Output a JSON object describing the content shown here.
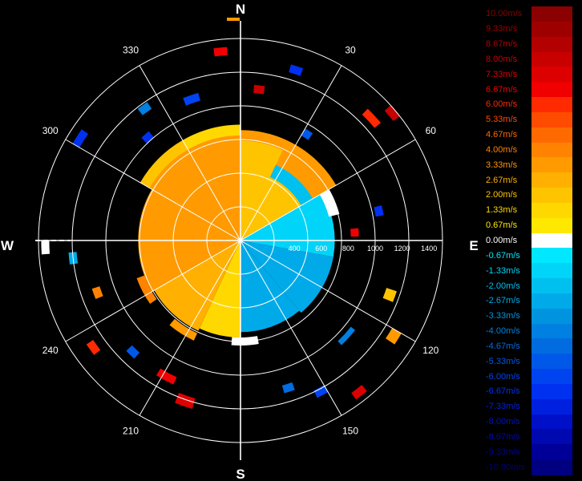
{
  "chart_data": {
    "type": "polar-heatmap",
    "cardinal": {
      "north": "N",
      "south": "S",
      "east": "E",
      "west": "W"
    },
    "azimuth_labels": [
      {
        "deg": 30,
        "text": "30"
      },
      {
        "deg": 60,
        "text": "60"
      },
      {
        "deg": 120,
        "text": "120"
      },
      {
        "deg": 150,
        "text": "150"
      },
      {
        "deg": 210,
        "text": "210"
      },
      {
        "deg": 240,
        "text": "240"
      },
      {
        "deg": 300,
        "text": "300"
      },
      {
        "deg": 330,
        "text": "330"
      }
    ],
    "range_ticks": [
      {
        "value": 400,
        "text": "400"
      },
      {
        "value": 600,
        "text": "600"
      },
      {
        "value": 800,
        "text": "800"
      },
      {
        "value": 1000,
        "text": "1000"
      },
      {
        "value": 1200,
        "text": "1200"
      },
      {
        "value": 1400,
        "text": "1400"
      }
    ],
    "range_max": 1500,
    "ring_count": 6,
    "radial_spoke_step_deg": 30,
    "colorbar": [
      {
        "label": "10.00m/s",
        "value": 10.0,
        "color": "#8b0000"
      },
      {
        "label": "9.33m/s",
        "value": 9.33,
        "color": "#9e0000"
      },
      {
        "label": "8.67m/s",
        "value": 8.67,
        "color": "#b30000"
      },
      {
        "label": "8.00m/s",
        "value": 8.0,
        "color": "#c80000"
      },
      {
        "label": "7.33m/s",
        "value": 7.33,
        "color": "#dd0000"
      },
      {
        "label": "6.67m/s",
        "value": 6.67,
        "color": "#f00000"
      },
      {
        "label": "6.00m/s",
        "value": 6.0,
        "color": "#ff2a00"
      },
      {
        "label": "5.33m/s",
        "value": 5.33,
        "color": "#ff4b00"
      },
      {
        "label": "4.67m/s",
        "value": 4.67,
        "color": "#ff6a00"
      },
      {
        "label": "4.00m/s",
        "value": 4.0,
        "color": "#ff8300"
      },
      {
        "label": "3.33m/s",
        "value": 3.33,
        "color": "#ff9a00"
      },
      {
        "label": "2.67m/s",
        "value": 2.67,
        "color": "#ffb000"
      },
      {
        "label": "2.00m/s",
        "value": 2.0,
        "color": "#ffc400"
      },
      {
        "label": "1.33m/s",
        "value": 1.33,
        "color": "#ffd800"
      },
      {
        "label": "0.67m/s",
        "value": 0.67,
        "color": "#ffe800"
      },
      {
        "label": "0.00m/s",
        "value": 0.0,
        "color": "#ffffff"
      },
      {
        "label": "-0.67m/s",
        "value": -0.67,
        "color": "#00e8ff"
      },
      {
        "label": "-1.33m/s",
        "value": -1.33,
        "color": "#00d4f8"
      },
      {
        "label": "-2.00m/s",
        "value": -2.0,
        "color": "#00c0f0"
      },
      {
        "label": "-2.67m/s",
        "value": -2.67,
        "color": "#00aae8"
      },
      {
        "label": "-3.33m/s",
        "value": -3.33,
        "color": "#0094e0"
      },
      {
        "label": "-4.00m/s",
        "value": -4.0,
        "color": "#0080e0"
      },
      {
        "label": "-4.67m/s",
        "value": -4.67,
        "color": "#006ce0"
      },
      {
        "label": "-5.33m/s",
        "value": -5.33,
        "color": "#0058e8"
      },
      {
        "label": "-6.00m/s",
        "value": -6.0,
        "color": "#0044f0"
      },
      {
        "label": "-6.67m/s",
        "value": -6.67,
        "color": "#0030f0"
      },
      {
        "label": "-7.33m/s",
        "value": -7.33,
        "color": "#0020e0"
      },
      {
        "label": "-8.00m/s",
        "value": -8.0,
        "color": "#0010c8"
      },
      {
        "label": "-8.67m/s",
        "value": -8.67,
        "color": "#0008b0"
      },
      {
        "label": "-9.33m/s",
        "value": -9.33,
        "color": "#000098"
      },
      {
        "label": "-10.00m/s",
        "value": -10.0,
        "color": "#000080"
      }
    ],
    "bins": [
      {
        "az": [
          300,
          60
        ],
        "r": [
          0,
          820
        ],
        "value": 3.0
      },
      {
        "az": [
          270,
          300
        ],
        "r": [
          0,
          760
        ],
        "value": 3.4
      },
      {
        "az": [
          240,
          270
        ],
        "r": [
          0,
          760
        ],
        "value": 3.2
      },
      {
        "az": [
          205,
          240
        ],
        "r": [
          0,
          740
        ],
        "value": 2.6
      },
      {
        "az": [
          180,
          205
        ],
        "r": [
          0,
          720
        ],
        "value": 1.6
      },
      {
        "az": [
          0,
          25
        ],
        "r": [
          0,
          740
        ],
        "value": 2.2
      },
      {
        "az": [
          25,
          60
        ],
        "r": [
          0,
          520
        ],
        "value": 1.8
      },
      {
        "az": [
          25,
          60
        ],
        "r": [
          520,
          620
        ],
        "value": -2.0
      },
      {
        "az": [
          60,
          100
        ],
        "r": [
          0,
          700
        ],
        "value": -1.6
      },
      {
        "az": [
          100,
          140
        ],
        "r": [
          0,
          700
        ],
        "value": -2.6
      },
      {
        "az": [
          140,
          180
        ],
        "r": [
          0,
          680
        ],
        "value": -3.0
      },
      {
        "az": [
          330,
          360
        ],
        "r": [
          780,
          860
        ],
        "value": 1.4
      },
      {
        "az": [
          300,
          330
        ],
        "r": [
          780,
          860
        ],
        "value": 2.0
      },
      {
        "az": [
          60,
          75
        ],
        "r": [
          680,
          760
        ],
        "value": 0.0
      },
      {
        "az": [
          170,
          185
        ],
        "r": [
          720,
          780
        ],
        "value": 0.0
      },
      {
        "az": [
          235,
          250
        ],
        "r": [
          760,
          820
        ],
        "value": 4.0
      },
      {
        "az": [
          205,
          220
        ],
        "r": [
          760,
          820
        ],
        "value": 3.4
      },
      {
        "az": [
          128,
          136
        ],
        "r": [
          1040,
          1080
        ],
        "value": -4.0
      },
      {
        "az": [
          44,
          50
        ],
        "r": [
          1300,
          1360
        ],
        "value": 6.2
      },
      {
        "az": [
          48,
          52
        ],
        "r": [
          1440,
          1500
        ],
        "value": 8.0
      },
      {
        "az": [
          16,
          20
        ],
        "r": [
          1300,
          1360
        ],
        "value": -7.0
      },
      {
        "az": [
          338,
          344
        ],
        "r": [
          1080,
          1140
        ],
        "value": -6.2
      },
      {
        "az": [
          300,
          305
        ],
        "r": [
          1380,
          1440
        ],
        "value": -7.0
      },
      {
        "az": [
          205,
          212
        ],
        "r": [
          1120,
          1180
        ],
        "value": 6.6
      },
      {
        "az": [
          196,
          202
        ],
        "r": [
          1220,
          1300
        ],
        "value": 7.4
      },
      {
        "az": [
          120,
          124
        ],
        "r": [
          1300,
          1380
        ],
        "value": 3.6
      },
      {
        "az": [
          108,
          112
        ],
        "r": [
          1140,
          1220
        ],
        "value": 2.2
      },
      {
        "az": [
          266,
          270
        ],
        "r": [
          1420,
          1480
        ],
        "value": 0.0
      },
      {
        "az": [
          262,
          266
        ],
        "r": [
          1220,
          1280
        ],
        "value": -2.8
      },
      {
        "az": [
          248,
          252
        ],
        "r": [
          1100,
          1160
        ],
        "value": 4.2
      },
      {
        "az": [
          222,
          226
        ],
        "r": [
          1120,
          1180
        ],
        "value": -5.4
      },
      {
        "az": [
          232,
          236
        ],
        "r": [
          1320,
          1380
        ],
        "value": 6.0
      },
      {
        "az": [
          5,
          9
        ],
        "r": [
          1100,
          1160
        ],
        "value": 7.8
      },
      {
        "az": [
          352,
          356
        ],
        "r": [
          1380,
          1440
        ],
        "value": 6.6
      },
      {
        "az": [
          30,
          34
        ],
        "r": [
          900,
          960
        ],
        "value": -5.2
      },
      {
        "az": [
          150,
          154
        ],
        "r": [
          1240,
          1300
        ],
        "value": -6.2
      },
      {
        "az": [
          140,
          144
        ],
        "r": [
          1400,
          1460
        ],
        "value": 7.2
      },
      {
        "az": [
          160,
          164
        ],
        "r": [
          1120,
          1180
        ],
        "value": -4.6
      },
      {
        "az": [
          84,
          88
        ],
        "r": [
          820,
          880
        ],
        "value": 6.6
      },
      {
        "az": [
          76,
          80
        ],
        "r": [
          1020,
          1080
        ],
        "value": -6.8
      },
      {
        "az": [
          322,
          326
        ],
        "r": [
          1180,
          1240
        ],
        "value": -3.8
      },
      {
        "az": [
          316,
          320
        ],
        "r": [
          1000,
          1060
        ],
        "value": -6.6
      }
    ]
  }
}
